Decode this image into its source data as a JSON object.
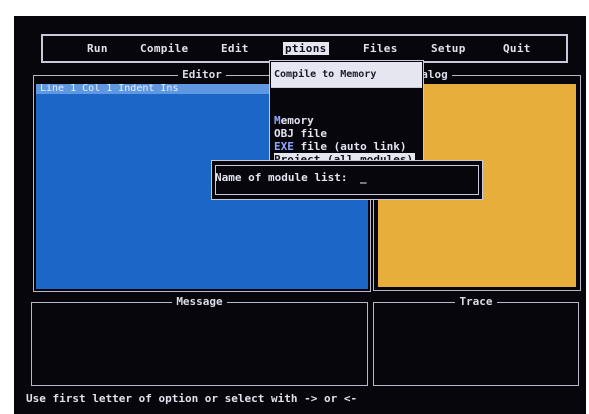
{
  "menu": {
    "items": [
      "Run",
      "Compile",
      "Edit",
      "ptions",
      "Files",
      "Setup",
      "Quit"
    ],
    "active_index": 3
  },
  "panels": {
    "editor_title": "Editor",
    "dialog_title": "Dialog",
    "message_title": "Message",
    "trace_title": "Trace"
  },
  "editor": {
    "status_text": "Line 1    Col 1    Indent  Ins"
  },
  "options_menu": {
    "header": "Compile to Memory",
    "items": [
      {
        "hot": "M",
        "rest": "emory"
      },
      {
        "hot": "",
        "rest": "OBJ file"
      },
      {
        "hot": "EXE",
        "rest": " file (auto link)"
      },
      {
        "hot": "",
        "rest": "Project (all modules)"
      }
    ],
    "selected_index": 3
  },
  "prompt": {
    "label": "Name of module list:",
    "value": "_"
  },
  "hint": "Use first letter of option  or  select with  ->  or  <-",
  "colors": {
    "background": "#06060c",
    "editor_fill": "#1b66c7",
    "dialog_fill": "#e8ae3c",
    "menu_highlight": "#e6e6f0",
    "text": "#dcdce8"
  }
}
